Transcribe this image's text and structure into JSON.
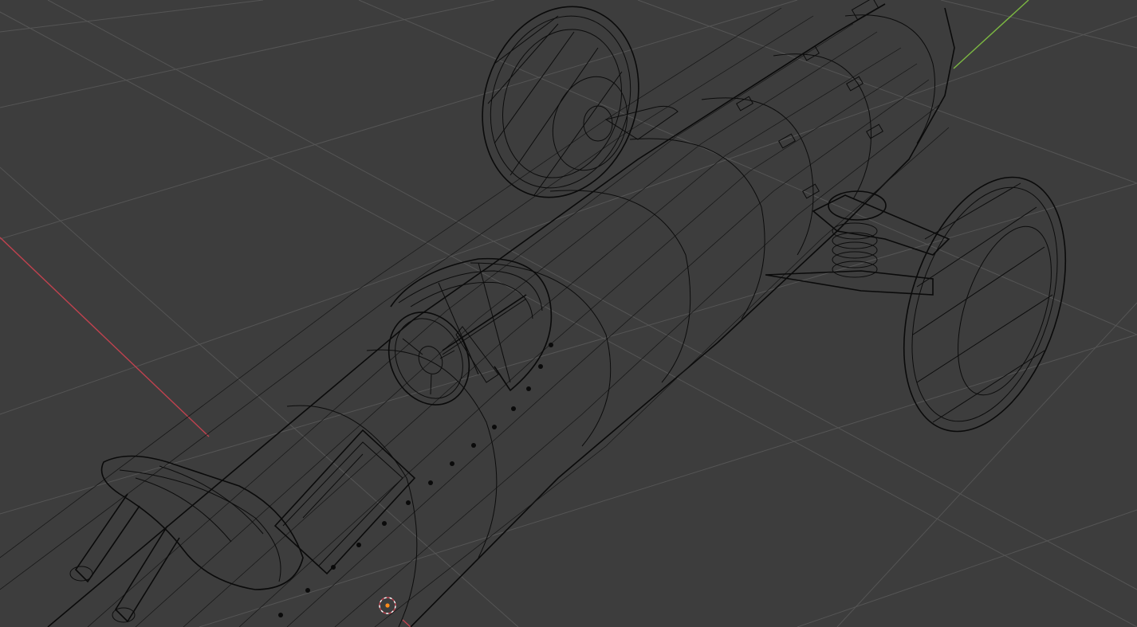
{
  "viewport": {
    "mode": "wireframe",
    "background_color": "#3d3d3d",
    "grid_color": "#555555",
    "wire_color": "#0c0c0c",
    "axis_x_color": "#c0424f",
    "axis_y_color": "#7cb842",
    "cursor_color": "#ff8c1a"
  },
  "scene": {
    "object": "race-car-wireframe",
    "icons": {
      "cursor": "3d-cursor-icon",
      "car": "car-model-icon"
    }
  }
}
